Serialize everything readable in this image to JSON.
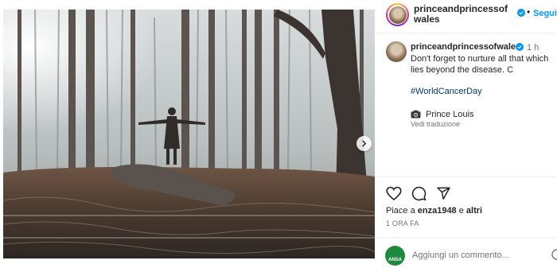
{
  "post": {
    "image_alt_icon": "forest-photo",
    "next_icon": "chevron-right-icon"
  },
  "header": {
    "username": "princeandprincessofwales",
    "separator": "•",
    "follow_label": "Segui"
  },
  "caption": {
    "username": "princeandprincessofwales",
    "time": "1 h",
    "text": "Don't forget to nurture all that which lies beyond the disease. C",
    "hashtag": "#WorldCancerDay",
    "credit_icon": "camera-icon",
    "credit": "Prince Louis",
    "see_translation": "Vedi traduzione"
  },
  "actions": {
    "like_icon": "heart-icon",
    "comment_icon": "comment-icon",
    "share_icon": "send-icon"
  },
  "likes": {
    "prefix": "Piace a ",
    "user": "enza1948",
    "middle": " e ",
    "others": "altri"
  },
  "time_ago": "1 ORA FA",
  "comment": {
    "badge_text": "ANSA",
    "placeholder": "Aggiungi un commento..."
  },
  "colors": {
    "accent_blue": "#0095f6",
    "hashtag_blue": "#00376b",
    "ansa_green": "#1d8a3e"
  }
}
